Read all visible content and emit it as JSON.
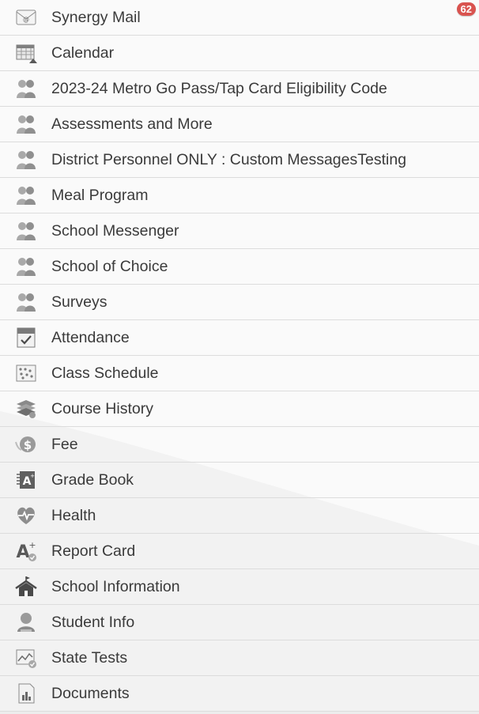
{
  "menu": {
    "items": [
      {
        "label": "Synergy Mail",
        "icon": "mail-icon",
        "badge": "62"
      },
      {
        "label": "Calendar",
        "icon": "calendar-icon"
      },
      {
        "label": "2023-24 Metro Go Pass/Tap Card Eligibility Code",
        "icon": "group-icon"
      },
      {
        "label": "Assessments and More",
        "icon": "group-icon"
      },
      {
        "label": "District Personnel ONLY : Custom MessagesTesting",
        "icon": "group-icon"
      },
      {
        "label": "Meal Program",
        "icon": "group-icon"
      },
      {
        "label": "School Messenger",
        "icon": "group-icon"
      },
      {
        "label": "School of Choice",
        "icon": "group-icon"
      },
      {
        "label": "Surveys",
        "icon": "group-icon"
      },
      {
        "label": "Attendance",
        "icon": "attendance-icon"
      },
      {
        "label": "Class Schedule",
        "icon": "class-schedule-icon"
      },
      {
        "label": "Course History",
        "icon": "course-history-icon"
      },
      {
        "label": "Fee",
        "icon": "fee-icon"
      },
      {
        "label": "Grade Book",
        "icon": "grade-book-icon"
      },
      {
        "label": "Health",
        "icon": "health-icon"
      },
      {
        "label": "Report Card",
        "icon": "report-card-icon"
      },
      {
        "label": "School Information",
        "icon": "school-information-icon"
      },
      {
        "label": "Student Info",
        "icon": "student-info-icon"
      },
      {
        "label": "State Tests",
        "icon": "state-tests-icon"
      },
      {
        "label": "Documents",
        "icon": "documents-icon"
      }
    ]
  }
}
